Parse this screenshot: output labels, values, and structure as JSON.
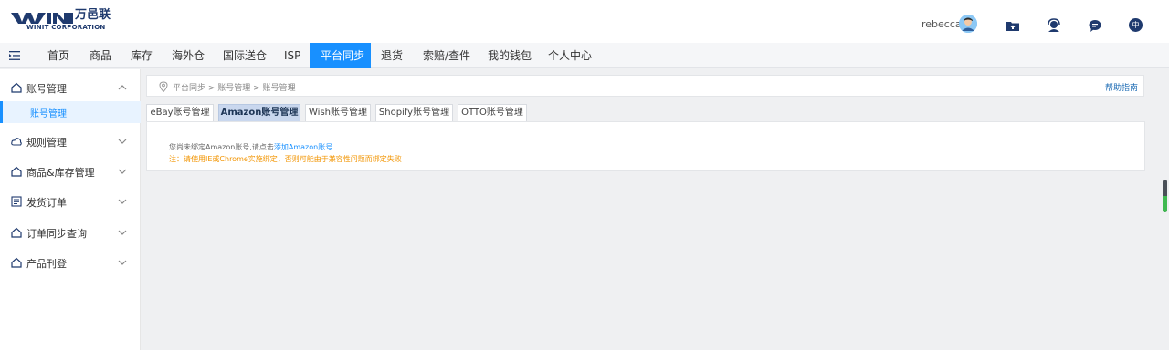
{
  "header": {
    "logo_cn": "万邑联",
    "logo_en": "WINIT CORPORATION",
    "user_name": "rebecca",
    "icons": [
      "upload-folder-icon",
      "support-agent-icon",
      "chat-bubble-icon",
      "language-icon"
    ],
    "language_label": "中",
    "brand_color": "#1f3a6e"
  },
  "nav": {
    "items": [
      {
        "label": "首页"
      },
      {
        "label": "商品"
      },
      {
        "label": "库存"
      },
      {
        "label": "海外仓"
      },
      {
        "label": "国际送仓"
      },
      {
        "label": "ISP"
      },
      {
        "label": "平台同步",
        "active": true
      },
      {
        "label": "退货"
      },
      {
        "label": "索赔/查件"
      },
      {
        "label": "我的钱包"
      },
      {
        "label": "个人中心"
      }
    ],
    "accent_color": "#1890ff"
  },
  "sidebar": {
    "groups": [
      {
        "label": "账号管理",
        "expanded": true,
        "icon": "home-icon"
      },
      {
        "label": "规则管理",
        "expanded": false,
        "icon": "cloud-icon"
      },
      {
        "label": "商品&库存管理",
        "expanded": false,
        "icon": "home-icon"
      },
      {
        "label": "发货订单",
        "expanded": false,
        "icon": "list-icon"
      },
      {
        "label": "订单同步查询",
        "expanded": false,
        "icon": "home-icon"
      },
      {
        "label": "产品刊登",
        "expanded": false,
        "icon": "home-icon"
      }
    ],
    "active_sub": "账号管理"
  },
  "breadcrumb": {
    "path": "平台同步 > 账号管理 > 账号管理",
    "help": "帮助指南"
  },
  "tabs": [
    {
      "label": "eBay账号管理"
    },
    {
      "label": "Amazon账号管理",
      "active": true
    },
    {
      "label": "Wish账号管理"
    },
    {
      "label": "Shopify账号管理"
    },
    {
      "label": "OTTO账号管理"
    }
  ],
  "panel": {
    "message_prefix": "您尚未绑定Amazon账号,请点击",
    "message_link": "添加Amazon账号",
    "warning": "注：请使用IE或Chrome实施绑定，否则可能由于兼容性问题而绑定失败",
    "warning_color": "#f29400"
  }
}
